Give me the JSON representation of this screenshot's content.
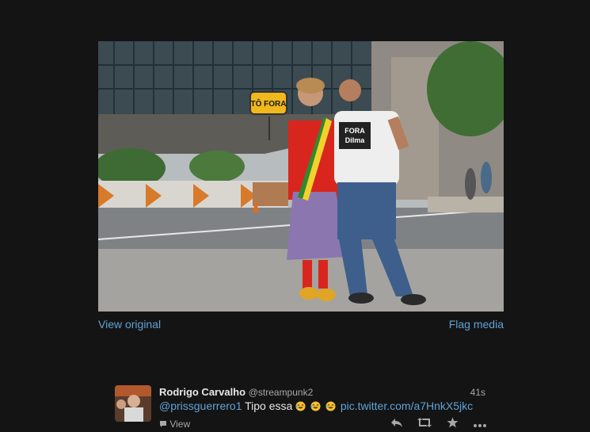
{
  "media": {
    "photo_sign_text": "TÔ FORA",
    "shirt_text_line1": "FORA",
    "shirt_text_line2": "Dilma",
    "view_original_label": "View original",
    "flag_media_label": "Flag media"
  },
  "tweet": {
    "fullname": "Rodrigo Carvalho",
    "username": "@streampunk2",
    "time": "41s",
    "mention": "@prissguerrero1",
    "text": " Tipo essa ",
    "link": "pic.twitter.com/a7HnkX5jkc",
    "view_label": "View",
    "emoji_count": 3
  },
  "colors": {
    "background": "#141414",
    "link": "#5fa3d6",
    "muted": "#a7a7a7"
  },
  "icons": {
    "reply": "reply-icon",
    "retweet": "retweet-icon",
    "favorite": "star-icon",
    "more": "more-icon",
    "view": "speech-bubble-icon"
  }
}
